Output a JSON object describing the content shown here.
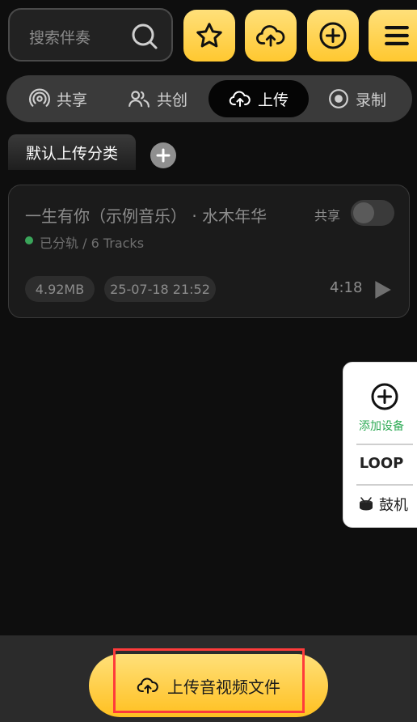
{
  "search": {
    "placeholder": "搜索伴奏"
  },
  "tabs": [
    {
      "label": "共享",
      "icon": "signal-icon"
    },
    {
      "label": "共创",
      "icon": "users-icon"
    },
    {
      "label": "上传",
      "icon": "cloud-upload-icon",
      "active": true
    },
    {
      "label": "录制",
      "icon": "record-icon"
    }
  ],
  "category": {
    "label": "默认上传分类"
  },
  "card": {
    "title": "一生有你（示例音乐） · 水木年华",
    "share_label": "共享",
    "status": "已分轨 / 6 Tracks",
    "size": "4.92MB",
    "date": "25-07-18 21:52",
    "duration": "4:18"
  },
  "side": {
    "add_device": "添加设备",
    "loop": "LOOP",
    "drum": "鼓机"
  },
  "bottom": {
    "upload_label": "上传音视频文件"
  },
  "colors": {
    "accent": "#ffc830",
    "active_tab": "#050505",
    "green": "#2eaa55",
    "highlight": "#ff3b3b"
  }
}
